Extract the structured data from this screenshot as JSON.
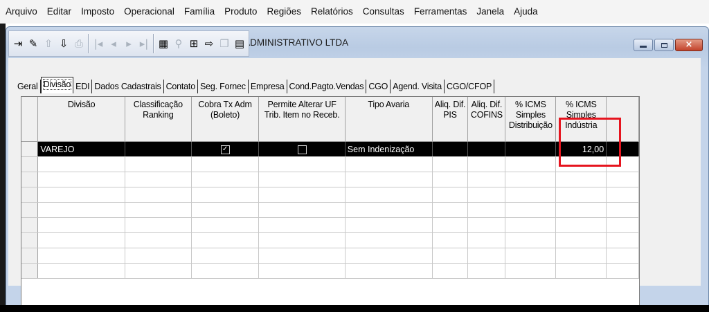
{
  "menu": [
    "Arquivo",
    "Editar",
    "Imposto",
    "Operacional",
    "Família",
    "Produto",
    "Regiões",
    "Relatórios",
    "Consultas",
    "Ferramentas",
    "Janela",
    "Ajuda"
  ],
  "window": {
    "title": "Fornecedor - NAPEIXOTO SERVICOS DE APOIO ADMINISTRATIVO LTDA",
    "buttons": {
      "minimize": "minimize-icon",
      "maximize": "maximize-icon",
      "close": "×"
    }
  },
  "toolbar": [
    {
      "name": "exit",
      "glyph": "⇥",
      "disabled": false
    },
    {
      "name": "edit",
      "glyph": "✎",
      "disabled": false
    },
    {
      "name": "import",
      "glyph": "⇧",
      "disabled": true
    },
    {
      "name": "export",
      "glyph": "⇩",
      "disabled": false
    },
    {
      "name": "print",
      "glyph": "⎙",
      "disabled": true
    },
    {
      "sep": true
    },
    {
      "name": "first",
      "glyph": "|◂",
      "disabled": true
    },
    {
      "name": "previous",
      "glyph": "◂",
      "disabled": true
    },
    {
      "name": "next",
      "glyph": "▸",
      "disabled": true
    },
    {
      "name": "last",
      "glyph": "▸|",
      "disabled": true
    },
    {
      "sep": true
    },
    {
      "name": "grid",
      "glyph": "▦",
      "disabled": false
    },
    {
      "name": "search",
      "glyph": "⚲",
      "disabled": true
    },
    {
      "name": "add-record",
      "glyph": "⊞",
      "disabled": false
    },
    {
      "name": "export-record",
      "glyph": "⇨",
      "disabled": false
    },
    {
      "name": "copy",
      "glyph": "❐",
      "disabled": true
    },
    {
      "name": "calendar",
      "glyph": "▤",
      "disabled": false
    }
  ],
  "tabs": [
    "Geral",
    "Divisão",
    "EDI",
    "Dados Cadastrais",
    "Contato",
    "Seg. Fornec",
    "Empresa",
    "Cond.Pagto.Vendas",
    "CGO",
    "Agend. Visita",
    "CGO/CFOP"
  ],
  "active_tab": "Divisão",
  "table": {
    "columns": [
      "Divisão",
      "Classificação Ranking",
      "Cobra Tx Adm (Boleto)",
      "Permite Alterar UF Trib. Item no Receb.",
      "Tipo Avaria",
      "Aliq. Dif. PIS",
      "Aliq. Dif. COFINS",
      "% ICMS Simples Distribuição",
      "% ICMS Simples Indústria"
    ],
    "rows": [
      {
        "divisao": "VAREJO",
        "classificacao": "",
        "cobra": true,
        "permite": false,
        "tipo_avaria": "Sem Indenização",
        "aliq_pis": "",
        "aliq_cofins": "",
        "icms_dist": "",
        "icms_ind": "12,00"
      }
    ],
    "empty_rows": 8
  },
  "highlight_color": "#e6141e"
}
